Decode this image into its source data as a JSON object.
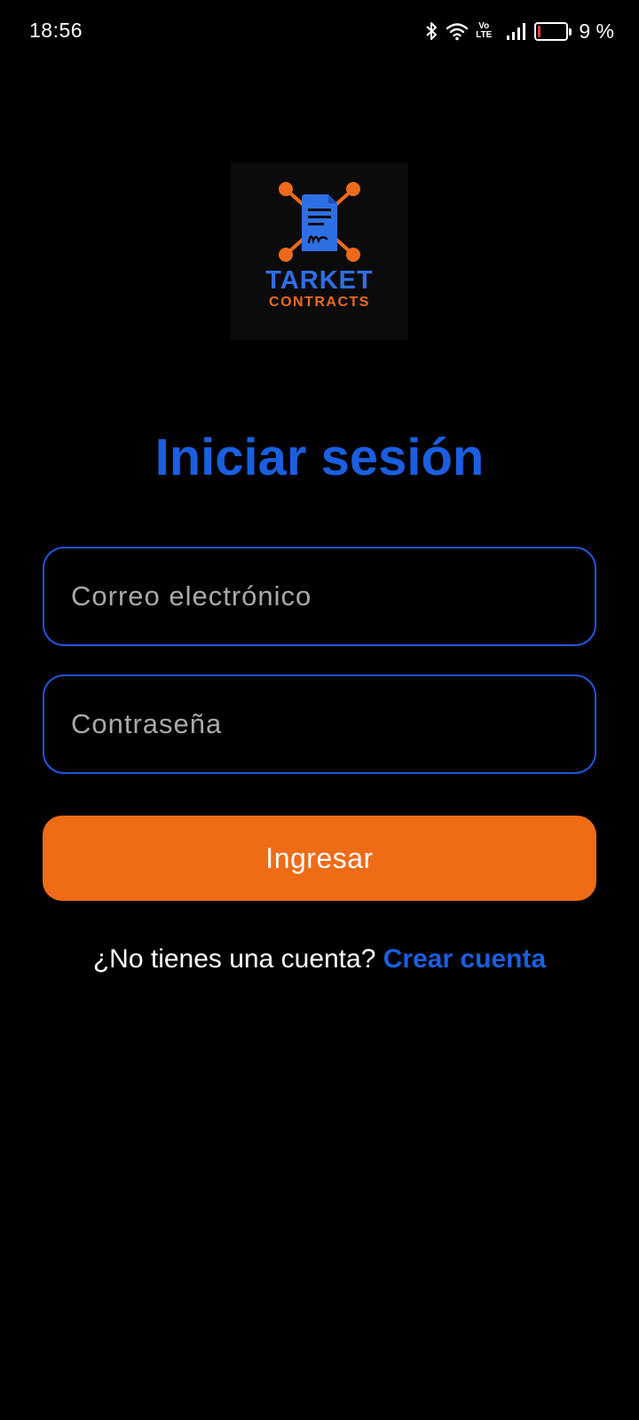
{
  "status_bar": {
    "time": "18:56",
    "volte_top": "Vo",
    "volte_bottom": "LTE",
    "battery_percent": "9 %",
    "battery_level": 0.09,
    "icons": [
      "bluetooth-icon",
      "wifi-icon",
      "volte-icon",
      "signal-icon",
      "battery-icon"
    ]
  },
  "logo": {
    "title": "TARKET",
    "subtitle": "CONTRACTS",
    "icon": "contract-document-icon"
  },
  "login": {
    "title": "Iniciar sesión",
    "email_placeholder": "Correo electrónico",
    "password_placeholder": "Contraseña",
    "submit_label": "Ingresar",
    "no_account_text": "¿No tienes una cuenta?",
    "create_account_label": "Crear cuenta"
  },
  "colors": {
    "background": "#000000",
    "primary_blue": "#1a5fe0",
    "accent_orange": "#f06b16",
    "placeholder_gray": "#a9a9a9"
  }
}
